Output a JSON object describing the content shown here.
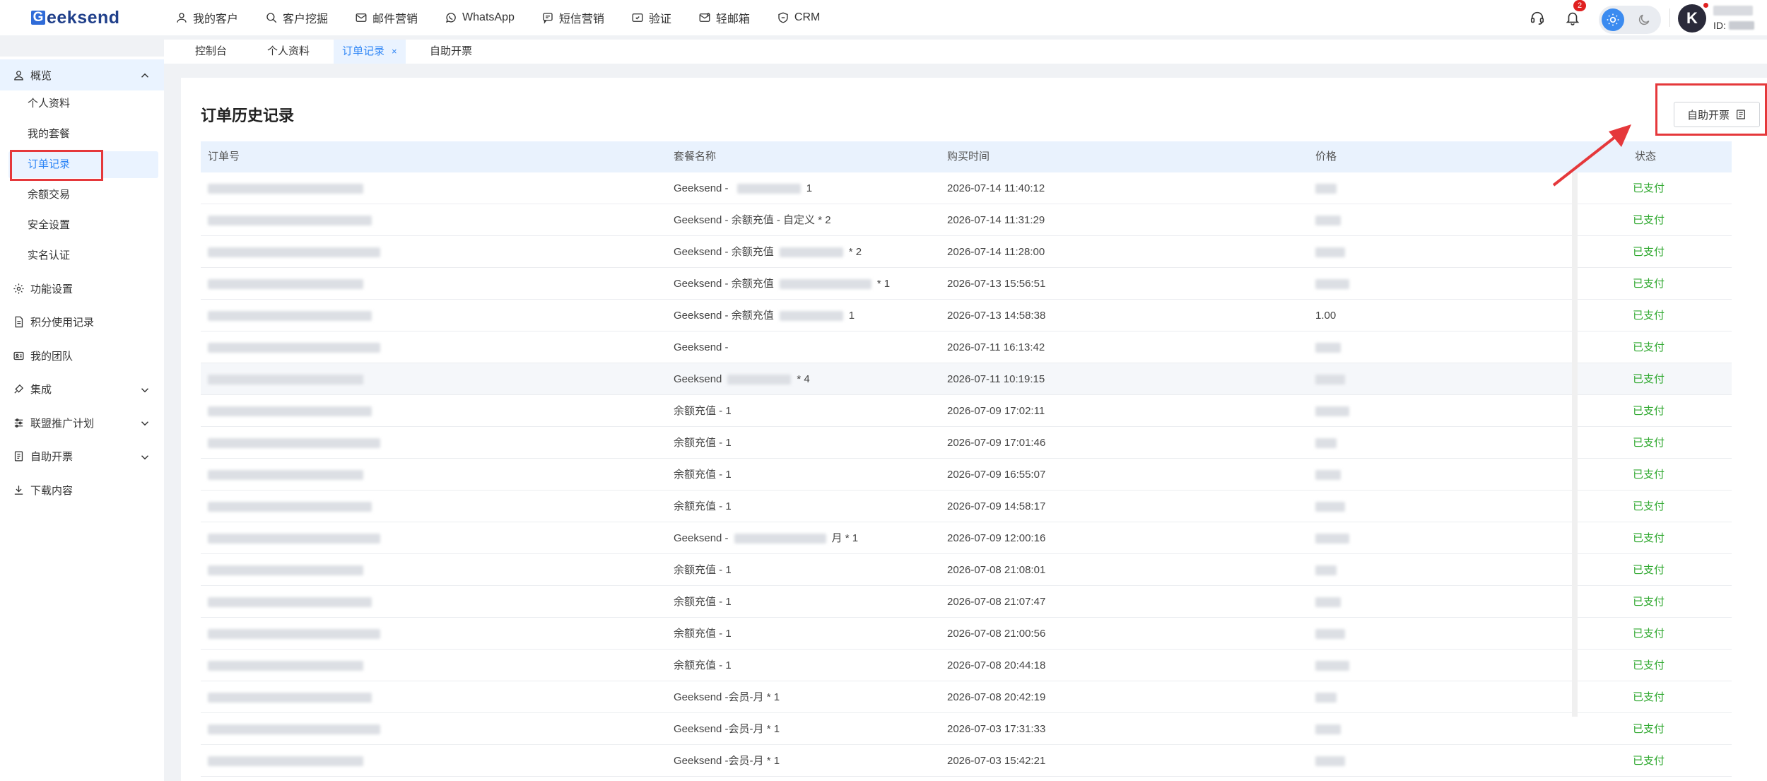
{
  "app": {
    "logo_text": "eeksend",
    "logo_mark": "G"
  },
  "topnav": [
    {
      "label": "我的客户",
      "icon": "user-icon"
    },
    {
      "label": "客户挖掘",
      "icon": "search-icon"
    },
    {
      "label": "邮件营销",
      "icon": "mail-icon"
    },
    {
      "label": "WhatsApp",
      "icon": "whatsapp-icon"
    },
    {
      "label": "短信营销",
      "icon": "sms-icon"
    },
    {
      "label": "验证",
      "icon": "verify-icon"
    },
    {
      "label": "轻邮箱",
      "icon": "light-mail-icon"
    },
    {
      "label": "CRM",
      "icon": "crm-icon"
    }
  ],
  "header": {
    "notification_count": "2",
    "user_id_label": "ID:",
    "avatar_letter": "K"
  },
  "tabs": [
    {
      "label": "控制台"
    },
    {
      "label": "个人资料"
    },
    {
      "label": "订单记录",
      "active": true,
      "close": "×"
    },
    {
      "label": "自助开票"
    }
  ],
  "sidebar": {
    "overview": {
      "label": "概览"
    },
    "sub": [
      {
        "label": "个人资料"
      },
      {
        "label": "我的套餐"
      },
      {
        "label": "订单记录",
        "active": true
      },
      {
        "label": "余额交易"
      },
      {
        "label": "安全设置"
      },
      {
        "label": "实名认证"
      }
    ],
    "groups": [
      {
        "label": "功能设置",
        "icon": "gear-icon"
      },
      {
        "label": "积分使用记录",
        "icon": "document-icon"
      },
      {
        "label": "我的团队",
        "icon": "team-card-icon"
      },
      {
        "label": "集成",
        "icon": "integration-icon",
        "expandable": true
      },
      {
        "label": "联盟推广计划",
        "icon": "sliders-icon",
        "expandable": true
      },
      {
        "label": "自助开票",
        "icon": "invoice-icon",
        "expandable": true
      },
      {
        "label": "下载内容",
        "icon": "download-icon"
      }
    ]
  },
  "main": {
    "title": "订单历史记录",
    "invoice_button": "自助开票",
    "columns": {
      "order_no": "订单号",
      "package": "套餐名称",
      "time": "购买时间",
      "price": "价格",
      "status": "状态"
    },
    "rows": [
      {
        "package": "Geeksend - ",
        "package_tail": "1",
        "time": "2026-07-14 11:40:12",
        "price": "",
        "status": "已支付"
      },
      {
        "package": "Geeksend - 余额充值 - 自定义 * 2",
        "package_tail": "",
        "time": "2026-07-14 11:31:29",
        "price": "",
        "status": "已支付"
      },
      {
        "package": "Geeksend - 余额充值",
        "package_tail": "* 2",
        "time": "2026-07-14 11:28:00",
        "price": "",
        "status": "已支付"
      },
      {
        "package": "Geeksend - 余额充值",
        "package_tail": "* 1",
        "time": "2026-07-13 15:56:51",
        "price": "",
        "status": "已支付"
      },
      {
        "package": "Geeksend - 余额充值",
        "package_tail": "1",
        "time": "2026-07-13 14:58:38",
        "price": "1.00",
        "status": "已支付"
      },
      {
        "package": "Geeksend - ",
        "package_tail": "",
        "time": "2026-07-11 16:13:42",
        "price": "",
        "status": "已支付"
      },
      {
        "package": "Geeksend",
        "package_tail": "* 4",
        "time": "2026-07-11 10:19:15",
        "price": "",
        "status": "已支付"
      },
      {
        "package": "余额充值 - 1",
        "package_tail": "",
        "time": "2026-07-09 17:02:11",
        "price": "",
        "status": "已支付"
      },
      {
        "package": "余额充值 - 1",
        "package_tail": "",
        "time": "2026-07-09 17:01:46",
        "price": "",
        "status": "已支付"
      },
      {
        "package": "余额充值 - 1",
        "package_tail": "",
        "time": "2026-07-09 16:55:07",
        "price": "",
        "status": "已支付"
      },
      {
        "package": "余额充值 - 1",
        "package_tail": "",
        "time": "2026-07-09 14:58:17",
        "price": "",
        "status": "已支付"
      },
      {
        "package": "Geeksend -",
        "package_tail": "月 * 1",
        "time": "2026-07-09 12:00:16",
        "price": "",
        "status": "已支付"
      },
      {
        "package": "余额充值 - 1",
        "package_tail": "",
        "time": "2026-07-08 21:08:01",
        "price": "",
        "status": "已支付"
      },
      {
        "package": "余额充值 - 1",
        "package_tail": "",
        "time": "2026-07-08 21:07:47",
        "price": "",
        "status": "已支付"
      },
      {
        "package": "余额充值 - 1",
        "package_tail": "",
        "time": "2026-07-08 21:00:56",
        "price": "",
        "status": "已支付"
      },
      {
        "package": "余额充值 - 1",
        "package_tail": "",
        "time": "2026-07-08 20:44:18",
        "price": "",
        "status": "已支付"
      },
      {
        "package": "Geeksend -会员-月 * 1",
        "package_tail": "",
        "time": "2026-07-08 20:42:19",
        "price": "",
        "status": "已支付"
      },
      {
        "package": "Geeksend -会员-月 * 1",
        "package_tail": "",
        "time": "2026-07-03 17:31:33",
        "price": "",
        "status": "已支付"
      },
      {
        "package": "Geeksend -会员-月 * 1",
        "package_tail": "",
        "time": "2026-07-03 15:42:21",
        "price": "",
        "status": "已支付"
      }
    ]
  },
  "colors": {
    "accent": "#2f86f6",
    "paid": "#2fa82f",
    "annotation": "#e5383b",
    "header_bg": "#e9f2fd"
  }
}
